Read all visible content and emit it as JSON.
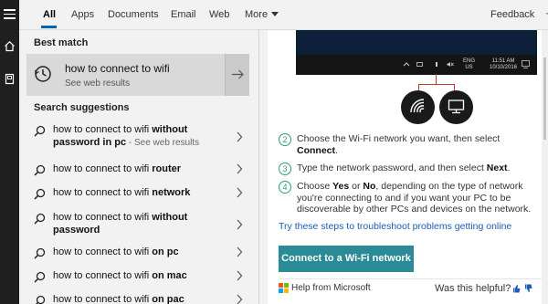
{
  "tabs": [
    {
      "label": "All",
      "active": true
    },
    {
      "label": "Apps"
    },
    {
      "label": "Documents"
    },
    {
      "label": "Email"
    },
    {
      "label": "Web"
    },
    {
      "label": "More"
    }
  ],
  "header": {
    "feedback_label": "Feedback",
    "more_options_glyph": "···"
  },
  "best_match": {
    "heading": "Best match",
    "title": "how to connect to wifi",
    "subtitle": "See web results",
    "icon": "history-icon"
  },
  "suggestions": {
    "heading": "Search suggestions",
    "items": [
      {
        "prefix": "how to connect to wifi ",
        "bold": "without password in pc",
        "suffix": " - See web results"
      },
      {
        "prefix": "how to connect to wifi ",
        "bold": "router",
        "suffix": ""
      },
      {
        "prefix": "how to connect to wifi ",
        "bold": "network",
        "suffix": ""
      },
      {
        "prefix": "how to connect to wifi ",
        "bold": "without password",
        "suffix": ""
      },
      {
        "prefix": "how to connect to wifi ",
        "bold": "on pc",
        "suffix": ""
      },
      {
        "prefix": "how to connect to wifi ",
        "bold": "on mac",
        "suffix": ""
      },
      {
        "prefix": "how to connect to wifi ",
        "bold": "on pac",
        "suffix": ""
      }
    ]
  },
  "preview": {
    "taskbar": {
      "lang_line1": "ENG",
      "lang_line2": "US",
      "time": "11:51 AM",
      "date": "10/10/2016"
    },
    "steps": [
      {
        "num": "2",
        "parts": [
          {
            "t": "Choose the Wi-Fi network you want, then select "
          },
          {
            "t": "Connect",
            "b": true
          },
          {
            "t": "."
          }
        ]
      },
      {
        "num": "3",
        "parts": [
          {
            "t": "Type the network password, and then select "
          },
          {
            "t": "Next",
            "b": true
          },
          {
            "t": "."
          }
        ]
      },
      {
        "num": "4",
        "parts": [
          {
            "t": "Choose "
          },
          {
            "t": "Yes",
            "b": true
          },
          {
            "t": " or "
          },
          {
            "t": "No",
            "b": true
          },
          {
            "t": ", depending on the type of network you're connecting to and if you want your PC to be discoverable by other PCs and devices on the network."
          }
        ]
      }
    ],
    "troubleshoot_link": "Try these steps to troubleshoot problems getting online",
    "cta_label": "Connect to a Wi-Fi network",
    "help_label": "Help from Microsoft",
    "helpful_label": "Was this helpful?"
  },
  "colors": {
    "accent": "#0067b8",
    "cta": "#2a8a95",
    "step": "#2e9d7a",
    "callout": "#c0392b",
    "link": "#1e5cb3"
  }
}
